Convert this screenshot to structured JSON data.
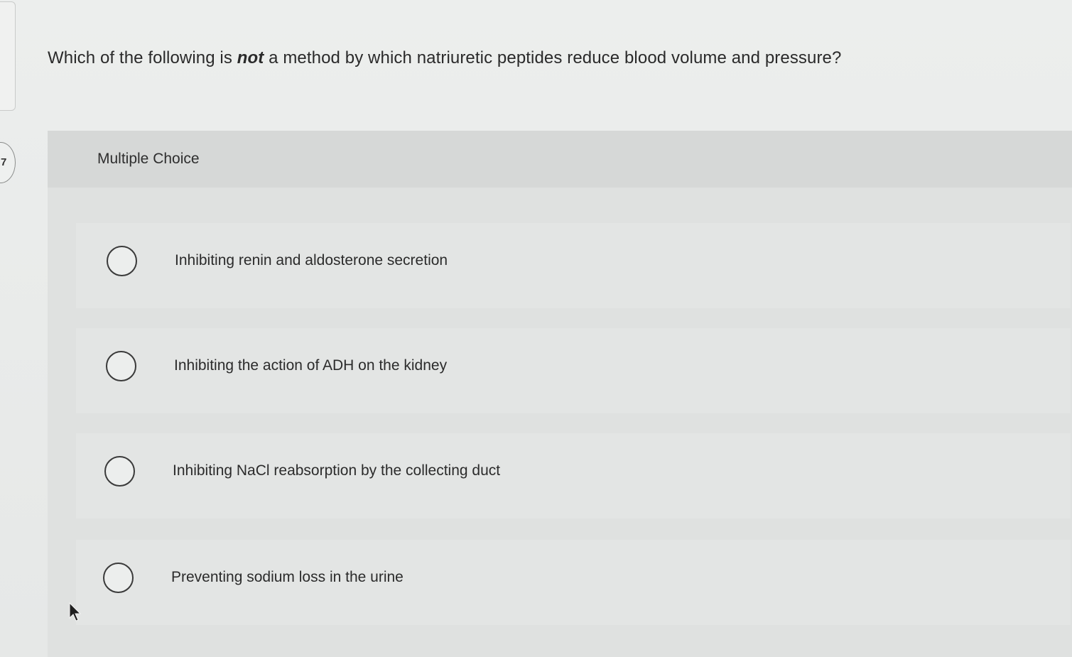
{
  "sidebar": {
    "question_number": "7"
  },
  "question": {
    "prefix": "Which of the following is ",
    "emphasis": "not",
    "suffix": " a method by which natriuretic peptides reduce blood volume and pressure?"
  },
  "multiple_choice": {
    "header": "Multiple Choice",
    "options": [
      {
        "label": "Inhibiting renin and aldosterone secretion"
      },
      {
        "label": "Inhibiting the action of ADH on the kidney"
      },
      {
        "label": "Inhibiting NaCl reabsorption by the collecting duct"
      },
      {
        "label": "Preventing sodium loss in the urine"
      }
    ]
  },
  "cursor": {
    "icon": "mouse-pointer-icon"
  }
}
